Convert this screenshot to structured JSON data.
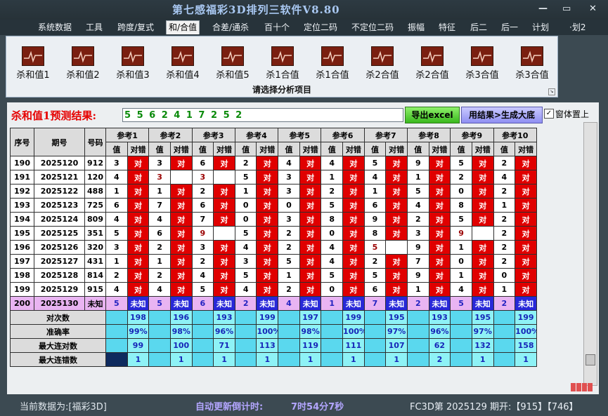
{
  "window": {
    "title": "第七感福彩3D排列三软件V8.80",
    "min": "—",
    "max": "▭",
    "close": "✕"
  },
  "menu": [
    "系统数据",
    "工具",
    "跨度/复式",
    "和/合值",
    "合差/通杀",
    "百十个",
    "定位二码",
    "不定位二码",
    "振幅",
    "特征",
    "后二",
    "后一",
    "计划",
    "·划2"
  ],
  "ribbon": {
    "buttons": [
      "杀和值1",
      "杀和值2",
      "杀和值3",
      "杀和值4",
      "杀和值5",
      "杀1合值",
      "杀1合值",
      "杀2合值",
      "杀2合值",
      "杀3合值",
      "杀3合值"
    ],
    "caption": "请选择分析项目"
  },
  "prediction": {
    "label": "杀和值1预测结果:",
    "value": "5 5 6 2 4 1 7 2 5 2",
    "export_button": "导出excel",
    "generate_button": "用结果>生成大底",
    "checkbox_label": "窗体置上",
    "checkbox_mark": "✓"
  },
  "table": {
    "headers": {
      "seq": "序号",
      "period": "期号",
      "number": "号码",
      "val": "值",
      "result": "对错"
    },
    "refs": [
      "参考1",
      "参考2",
      "参考3",
      "参考4",
      "参考5",
      "参考6",
      "参考7",
      "参考8",
      "参考9",
      "参考10"
    ],
    "rows": [
      {
        "seq": "190",
        "period": "2025120",
        "number": "912",
        "refs": [
          [
            "3",
            "对"
          ],
          [
            "3",
            "对"
          ],
          [
            "6",
            "对"
          ],
          [
            "2",
            "对"
          ],
          [
            "4",
            "对"
          ],
          [
            "4",
            "对"
          ],
          [
            "5",
            "对"
          ],
          [
            "9",
            "对"
          ],
          [
            "5",
            "对"
          ],
          [
            "2",
            "对"
          ]
        ]
      },
      {
        "seq": "191",
        "period": "2025121",
        "number": "120",
        "refs": [
          [
            "4",
            "对"
          ],
          [
            "3",
            ""
          ],
          [
            "3",
            ""
          ],
          [
            "5",
            "对"
          ],
          [
            "3",
            "对"
          ],
          [
            "1",
            "对"
          ],
          [
            "4",
            "对"
          ],
          [
            "1",
            "对"
          ],
          [
            "2",
            "对"
          ],
          [
            "4",
            "对"
          ]
        ]
      },
      {
        "seq": "192",
        "period": "2025122",
        "number": "488",
        "refs": [
          [
            "1",
            "对"
          ],
          [
            "1",
            "对"
          ],
          [
            "2",
            "对"
          ],
          [
            "1",
            "对"
          ],
          [
            "3",
            "对"
          ],
          [
            "2",
            "对"
          ],
          [
            "1",
            "对"
          ],
          [
            "5",
            "对"
          ],
          [
            "0",
            "对"
          ],
          [
            "2",
            "对"
          ]
        ]
      },
      {
        "seq": "193",
        "period": "2025123",
        "number": "725",
        "refs": [
          [
            "6",
            "对"
          ],
          [
            "7",
            "对"
          ],
          [
            "6",
            "对"
          ],
          [
            "0",
            "对"
          ],
          [
            "0",
            "对"
          ],
          [
            "5",
            "对"
          ],
          [
            "6",
            "对"
          ],
          [
            "4",
            "对"
          ],
          [
            "8",
            "对"
          ],
          [
            "1",
            "对"
          ]
        ]
      },
      {
        "seq": "194",
        "period": "2025124",
        "number": "809",
        "refs": [
          [
            "4",
            "对"
          ],
          [
            "4",
            "对"
          ],
          [
            "7",
            "对"
          ],
          [
            "0",
            "对"
          ],
          [
            "3",
            "对"
          ],
          [
            "8",
            "对"
          ],
          [
            "9",
            "对"
          ],
          [
            "2",
            "对"
          ],
          [
            "5",
            "对"
          ],
          [
            "2",
            "对"
          ]
        ]
      },
      {
        "seq": "195",
        "period": "2025125",
        "number": "351",
        "refs": [
          [
            "5",
            "对"
          ],
          [
            "6",
            "对"
          ],
          [
            "9",
            ""
          ],
          [
            "5",
            "对"
          ],
          [
            "2",
            "对"
          ],
          [
            "0",
            "对"
          ],
          [
            "8",
            "对"
          ],
          [
            "3",
            "对"
          ],
          [
            "9",
            ""
          ],
          [
            "2",
            "对"
          ]
        ]
      },
      {
        "seq": "196",
        "period": "2025126",
        "number": "320",
        "refs": [
          [
            "3",
            "对"
          ],
          [
            "2",
            "对"
          ],
          [
            "3",
            "对"
          ],
          [
            "4",
            "对"
          ],
          [
            "2",
            "对"
          ],
          [
            "4",
            "对"
          ],
          [
            "5",
            ""
          ],
          [
            "9",
            "对"
          ],
          [
            "1",
            "对"
          ],
          [
            "2",
            "对"
          ]
        ]
      },
      {
        "seq": "197",
        "period": "2025127",
        "number": "431",
        "refs": [
          [
            "1",
            "对"
          ],
          [
            "1",
            "对"
          ],
          [
            "2",
            "对"
          ],
          [
            "3",
            "对"
          ],
          [
            "5",
            "对"
          ],
          [
            "4",
            "对"
          ],
          [
            "2",
            "对"
          ],
          [
            "7",
            "对"
          ],
          [
            "0",
            "对"
          ],
          [
            "2",
            "对"
          ]
        ]
      },
      {
        "seq": "198",
        "period": "2025128",
        "number": "814",
        "refs": [
          [
            "2",
            "对"
          ],
          [
            "2",
            "对"
          ],
          [
            "4",
            "对"
          ],
          [
            "5",
            "对"
          ],
          [
            "1",
            "对"
          ],
          [
            "5",
            "对"
          ],
          [
            "5",
            "对"
          ],
          [
            "9",
            "对"
          ],
          [
            "1",
            "对"
          ],
          [
            "0",
            "对"
          ]
        ]
      },
      {
        "seq": "199",
        "period": "2025129",
        "number": "915",
        "refs": [
          [
            "4",
            "对"
          ],
          [
            "4",
            "对"
          ],
          [
            "5",
            "对"
          ],
          [
            "4",
            "对"
          ],
          [
            "2",
            "对"
          ],
          [
            "0",
            "对"
          ],
          [
            "6",
            "对"
          ],
          [
            "1",
            "对"
          ],
          [
            "4",
            "对"
          ],
          [
            "1",
            "对"
          ]
        ]
      }
    ],
    "pending": {
      "seq": "200",
      "period": "2025130",
      "number": "未知",
      "refs": [
        [
          "5",
          "未知"
        ],
        [
          "5",
          "未知"
        ],
        [
          "6",
          "未知"
        ],
        [
          "2",
          "未知"
        ],
        [
          "4",
          "未知"
        ],
        [
          "1",
          "未知"
        ],
        [
          "7",
          "未知"
        ],
        [
          "2",
          "未知"
        ],
        [
          "5",
          "未知"
        ],
        [
          "2",
          "未知"
        ]
      ]
    },
    "stats": [
      {
        "label": "对次数",
        "values": [
          "198",
          "196",
          "193",
          "199",
          "197",
          "199",
          "195",
          "193",
          "195",
          "199"
        ]
      },
      {
        "label": "准确率",
        "values": [
          "99%",
          "98%",
          "96%",
          "100%",
          "98%",
          "100%",
          "97%",
          "96%",
          "97%",
          "100%"
        ]
      },
      {
        "label": "最大连对数",
        "values": [
          "99",
          "100",
          "71",
          "113",
          "119",
          "111",
          "107",
          "62",
          "132",
          "158"
        ]
      },
      {
        "label": "最大连错数",
        "values": [
          "1",
          "1",
          "1",
          "1",
          "1",
          "1",
          "1",
          "2",
          "1",
          "1"
        ]
      }
    ]
  },
  "status": {
    "data_source": "当前数据为:[福彩3D]",
    "countdown_label": "自动更新倒计时:",
    "countdown_value": "7时54分7秒",
    "latest": "FC3D第 2025129 期开:【915】【746】"
  },
  "colors": {
    "hit": "#e00000",
    "pending": "#e9b4f2",
    "stat": "#8ef2f6",
    "title": "#a9c8f2"
  }
}
